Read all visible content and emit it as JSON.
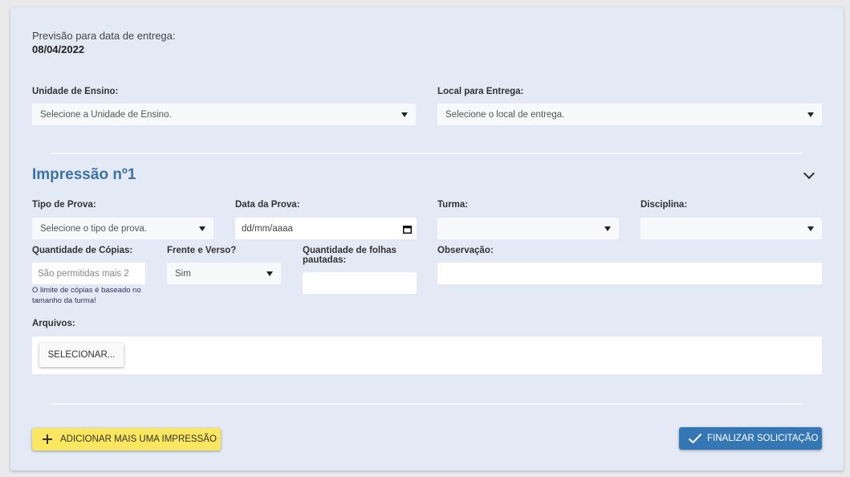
{
  "delivery": {
    "label": "Previsão para data de entrega:",
    "date": "08/04/2022"
  },
  "unit": {
    "label": "Unidade de Ensino:",
    "placeholder": "Selecione a Unidade de Ensino."
  },
  "delivery_location": {
    "label": "Local para Entrega:",
    "placeholder": "Selecione o local de entrega."
  },
  "print_section": {
    "title": "Impressão nº1",
    "exam_type": {
      "label": "Tipo de Prova:",
      "placeholder": "Selecione o tipo de prova."
    },
    "exam_date": {
      "label": "Data da Prova:",
      "placeholder": "dd/mm/aaaa"
    },
    "class": {
      "label": "Turma:",
      "value": ""
    },
    "subject": {
      "label": "Disciplina:",
      "value": ""
    },
    "copies": {
      "label": "Quantidade de Cópias:",
      "placeholder": "São permitidas mais 2",
      "hint": "O limite de cópias é baseado no tamanho da turma!"
    },
    "duplex": {
      "label": "Frente e Verso?",
      "value": "Sim"
    },
    "lined_sheets": {
      "label": "Quantidade de folhas pautadas:",
      "value": ""
    },
    "note": {
      "label": "Observação:",
      "value": ""
    },
    "files": {
      "label": "Arquivos:",
      "button": "SELECIONAR..."
    }
  },
  "actions": {
    "add_label": "ADICIONAR MAIS UMA IMPRESSÃO",
    "finish_label": "FINALIZAR SOLICITAÇÃO"
  },
  "colors": {
    "accent": "#3b73a7",
    "primary_button": "#3576b5",
    "secondary_button": "#fbe75f",
    "card_background": "#e3e9f5"
  },
  "icons": {
    "dropdown": "caret-down-icon",
    "collapse": "chevron-down-icon",
    "calendar": "calendar-icon",
    "add": "plus-icon",
    "finish": "check-icon"
  }
}
